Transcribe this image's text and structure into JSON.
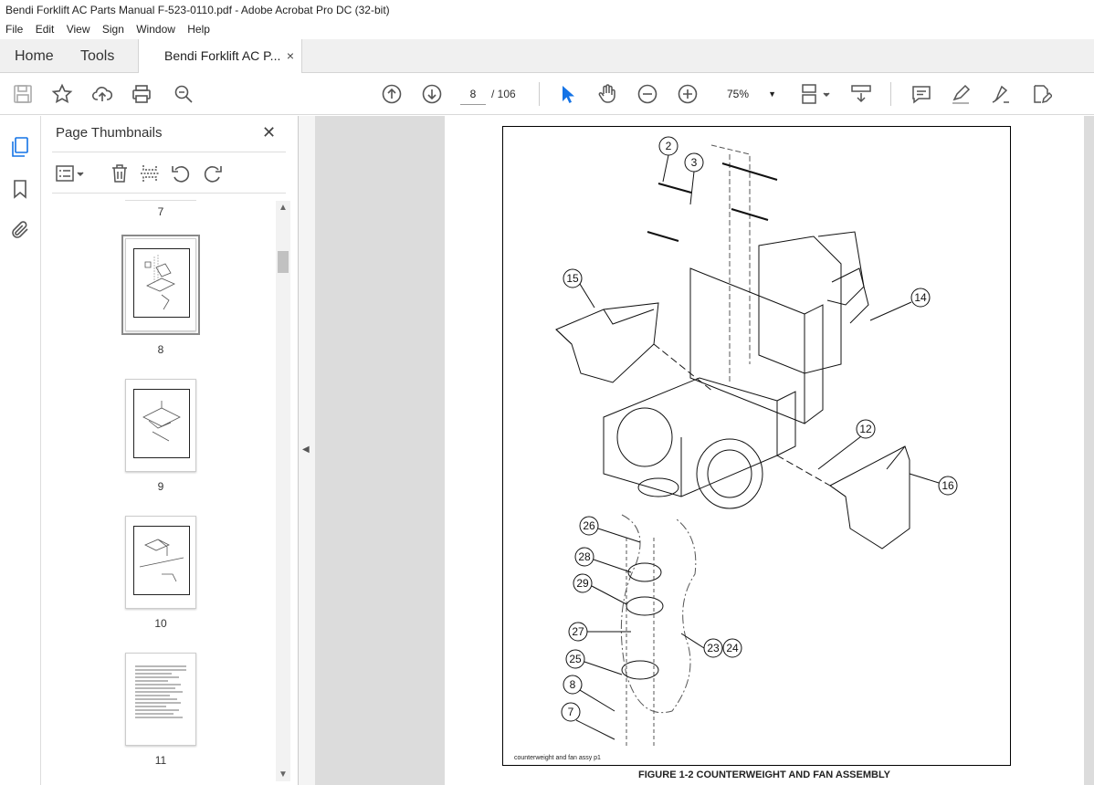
{
  "window": {
    "title": "Bendi Forklift AC Parts Manual F-523-0110.pdf - Adobe Acrobat Pro DC (32-bit)"
  },
  "menu": [
    "File",
    "Edit",
    "View",
    "Sign",
    "Window",
    "Help"
  ],
  "tabs": {
    "home": "Home",
    "tools": "Tools",
    "doc": "Bendi Forklift AC P...",
    "close": "×"
  },
  "toolbar": {
    "page_current": "8",
    "page_total": "/ 106",
    "zoom": "75%"
  },
  "icons": [
    "save-icon",
    "star-icon",
    "upload-icon",
    "print-icon",
    "zoom-search-icon",
    "prev-page-icon",
    "next-page-icon",
    "select-arrow-icon",
    "hand-icon",
    "zoom-out-icon",
    "zoom-in-icon",
    "page-layout-icon",
    "scroll-mode-icon",
    "comment-icon",
    "highlight-icon",
    "sign-icon",
    "edit-pdf-icon"
  ],
  "panel": {
    "title": "Page Thumbnails",
    "close": "✕",
    "thumbs": [
      {
        "label": "7"
      },
      {
        "label": "8",
        "selected": true
      },
      {
        "label": "9"
      },
      {
        "label": "10"
      },
      {
        "label": "11"
      }
    ]
  },
  "document": {
    "caption": "FIGURE 1-2 COUNTERWEIGHT AND FAN ASSEMBLY",
    "file_note": "counterweight and fan assy p1",
    "callouts": [
      "2",
      "3",
      "15",
      "14",
      "12",
      "16",
      "26",
      "28",
      "29",
      "27",
      "23",
      "24",
      "25",
      "8",
      "7"
    ]
  }
}
